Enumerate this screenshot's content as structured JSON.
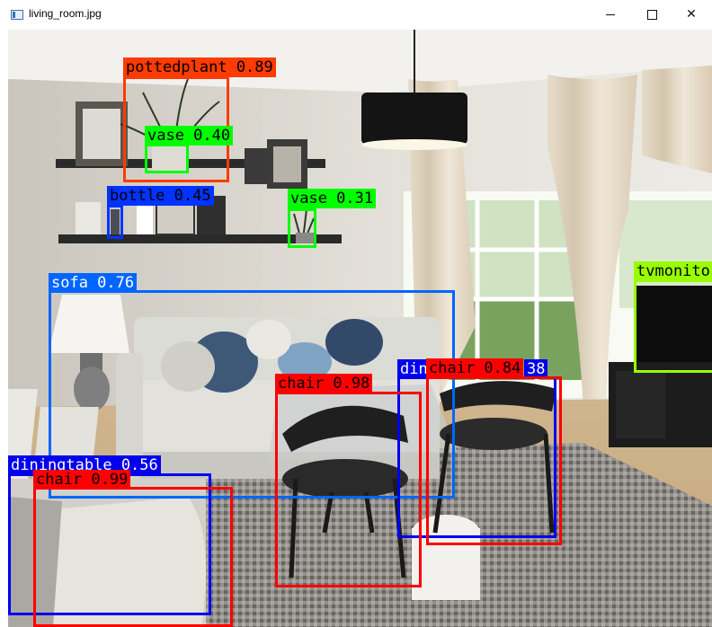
{
  "window": {
    "title": "living_room.jpg",
    "icon": "image-window-icon",
    "controls": {
      "minimize": "minimize-icon",
      "maximize": "maximize-icon",
      "close_glyph": "✕"
    }
  },
  "detections": [
    {
      "class": "pottedplant",
      "score": "0.89",
      "text": "pottedplant 0.89",
      "color": "#ff3b00",
      "text_color": "#000000"
    },
    {
      "class": "vase",
      "score": "0.40",
      "text": "vase 0.40",
      "color": "#00ff00",
      "text_color": "#000000"
    },
    {
      "class": "bottle",
      "score": "0.45",
      "text": "bottle 0.45",
      "color": "#0033ff",
      "text_color": "#000000"
    },
    {
      "class": "vase",
      "score": "0.31",
      "text": "vase 0.31",
      "color": "#00ff00",
      "text_color": "#000000"
    },
    {
      "class": "sofa",
      "score": "0.76",
      "text": "sofa 0.76",
      "color": "#0066ff",
      "text_color": "#ffffff"
    },
    {
      "class": "tvmonitor",
      "score": "",
      "text": "tvmonito",
      "color": "#99ff00",
      "text_color": "#000000"
    },
    {
      "class": "diningtable",
      "score": "",
      "text": "din",
      "color": "#0000ee",
      "text_color": "#ffffff"
    },
    {
      "class": "diningtable",
      "score": "0.38",
      "text": "38",
      "color": "#0000ee",
      "text_color": "#ffffff"
    },
    {
      "class": "chair",
      "score": "0.84",
      "text": "chair 0.84",
      "color": "#ff0000",
      "text_color": "#000000"
    },
    {
      "class": "chair",
      "score": "0.98",
      "text": "chair 0.98",
      "color": "#ff0000",
      "text_color": "#000000"
    },
    {
      "class": "diningtable",
      "score": "0.56",
      "text": "diningtable 0.56",
      "color": "#0000ee",
      "text_color": "#ffffff"
    },
    {
      "class": "chair",
      "score": "0.99",
      "text": "chair 0.99",
      "color": "#ff0000",
      "text_color": "#000000"
    }
  ]
}
